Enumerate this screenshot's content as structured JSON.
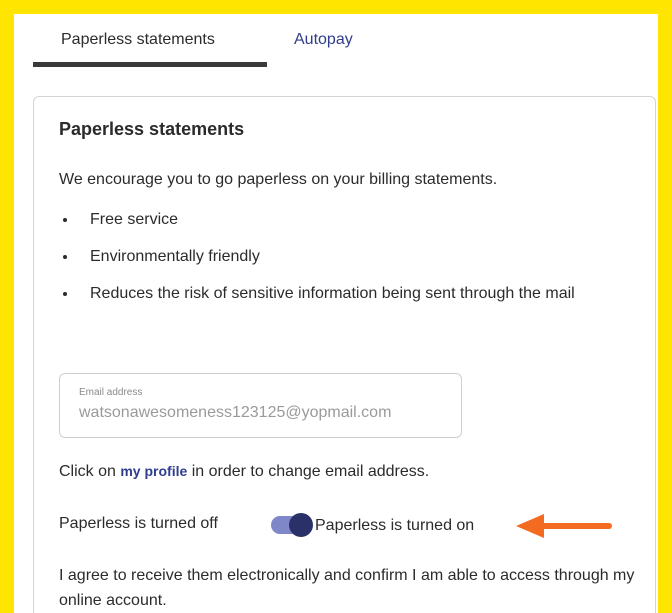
{
  "tabs": {
    "items": [
      {
        "label": "Paperless statements",
        "active": true
      },
      {
        "label": "Autopay",
        "active": false
      }
    ]
  },
  "card": {
    "title": "Paperless statements",
    "intro": "We encourage you to go paperless on your billing statements.",
    "bullets": [
      "Free service",
      "Environmentally friendly",
      "Reduces the risk of sensitive information being sent through the mail"
    ]
  },
  "email": {
    "label": "Email address",
    "value": "watsonawesomeness123125@yopmail.com"
  },
  "profile_line": {
    "prefix": "Click on ",
    "link": "my profile",
    "suffix": " in order to change email address."
  },
  "toggle": {
    "off_label": "Paperless is turned off",
    "on_label": "Paperless is turned on",
    "state": "on",
    "track_color": "#7f87c9",
    "knob_color": "#2a3168"
  },
  "annotation": {
    "arrow_color": "#F26B21",
    "arrow_icon": "arrow-left-icon"
  },
  "agreement": "I agree to receive them electronically and confirm I am able to access through my online account.",
  "colors": {
    "frame_border": "#FFE500",
    "link": "#2f3d8f"
  }
}
